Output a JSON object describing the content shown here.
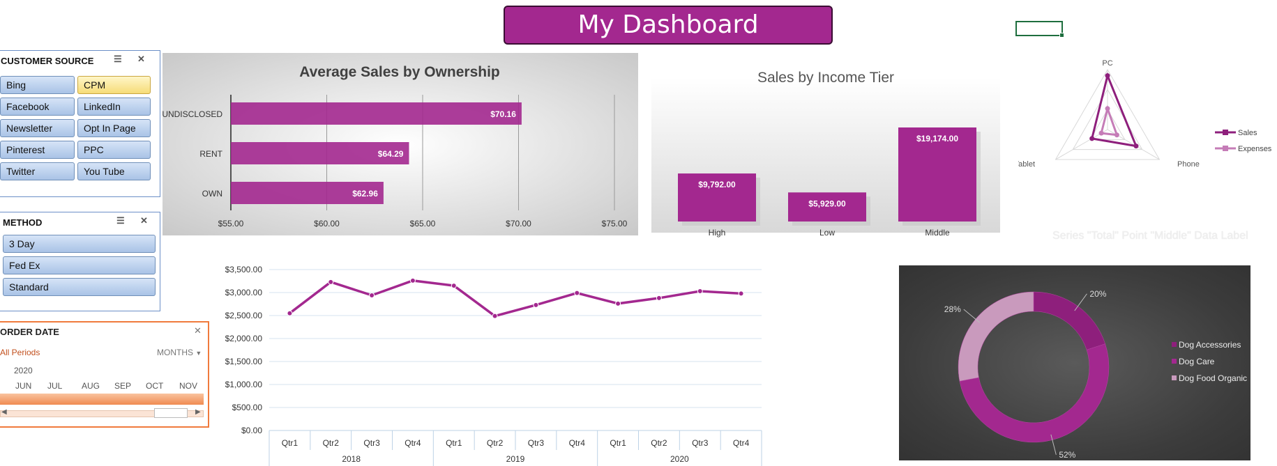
{
  "dashboard": {
    "title": "My Dashboard",
    "ghost_label": "Series \"Total\" Point \"Middle\" Data Label"
  },
  "slicers": {
    "customer_source": {
      "title": "CUSTOMER SOURCE",
      "items": [
        "Bing",
        "CPM",
        "Facebook",
        "LinkedIn",
        "Newsletter",
        "Opt In Page",
        "Pinterest",
        "PPC",
        "Twitter",
        "You Tube"
      ],
      "selected": "CPM"
    },
    "method": {
      "title": "METHOD",
      "items": [
        "3 Day",
        "Fed Ex",
        "Standard"
      ]
    }
  },
  "timeline": {
    "title": "ORDER DATE",
    "period_label": "All Periods",
    "level_label": "MONTHS",
    "year": "2020",
    "months": [
      "JUN",
      "JUL",
      "AUG",
      "SEP",
      "OCT",
      "NOV"
    ]
  },
  "charts": {
    "ownership": {
      "title": "Average Sales by Ownership",
      "data_labels": [
        "$70.16",
        "$64.29",
        "$62.96"
      ],
      "ticks": [
        "$55.00",
        "$60.00",
        "$65.00",
        "$70.00",
        "$75.00"
      ]
    },
    "income": {
      "title": "Sales by Income Tier",
      "data_labels": [
        "$9,792.00",
        "$5,929.00",
        "$19,174.00"
      ]
    },
    "radar": {
      "axes": [
        "PC",
        "Phone",
        "Tablet"
      ],
      "legend": [
        "Sales",
        "Expenses"
      ]
    },
    "trend": {
      "y_ticks": [
        "$3,500.00",
        "$3,000.00",
        "$2,500.00",
        "$2,000.00",
        "$1,500.00",
        "$1,000.00",
        "$500.00",
        "$0.00"
      ],
      "quarters": [
        "Qtr1",
        "Qtr2",
        "Qtr3",
        "Qtr4",
        "Qtr1",
        "Qtr2",
        "Qtr3",
        "Qtr4",
        "Qtr1",
        "Qtr2",
        "Qtr3",
        "Qtr4"
      ],
      "years": [
        "2018",
        "2019",
        "2020"
      ]
    },
    "donut": {
      "labels": [
        "20%",
        "52%",
        "28%"
      ],
      "legend": [
        "Dog Accessories",
        "Dog Care",
        "Dog Food Organic"
      ]
    }
  },
  "chart_data": [
    {
      "type": "bar",
      "title": "Average Sales by Ownership",
      "categories": [
        "UNDISCLOSED",
        "RENT",
        "OWN"
      ],
      "values": [
        70.16,
        64.29,
        62.96
      ],
      "xlim": [
        55,
        75
      ],
      "orientation": "horizontal",
      "color": "#a3288f"
    },
    {
      "type": "bar",
      "title": "Sales by Income Tier",
      "categories": [
        "High",
        "Low",
        "Middle"
      ],
      "values": [
        9792,
        5929,
        19174
      ],
      "color": "#a3288f"
    },
    {
      "type": "radar",
      "categories": [
        "PC",
        "Phone",
        "Tablet"
      ],
      "series": [
        {
          "name": "Sales",
          "values": [
            0.9,
            0.55,
            0.3
          ]
        },
        {
          "name": "Expenses",
          "values": [
            0.35,
            0.18,
            0.12
          ]
        }
      ],
      "legend": "right"
    },
    {
      "type": "line",
      "categories": [
        "Qtr1",
        "Qtr2",
        "Qtr3",
        "Qtr4",
        "Qtr1",
        "Qtr2",
        "Qtr3",
        "Qtr4",
        "Qtr1",
        "Qtr2",
        "Qtr3",
        "Qtr4"
      ],
      "groups": [
        "2018",
        "2019",
        "2020"
      ],
      "values": [
        2550,
        3230,
        2940,
        3260,
        3150,
        2490,
        2730,
        2990,
        2760,
        2880,
        3030,
        2980
      ],
      "ylim": [
        0,
        3500
      ],
      "color": "#a3288f"
    },
    {
      "type": "pie",
      "categories": [
        "Dog Accessories",
        "Dog Care",
        "Dog Food Organic"
      ],
      "values": [
        20,
        52,
        28
      ],
      "colors": [
        "#8e1f7c",
        "#a3288f",
        "#c99abd"
      ],
      "legend": "right"
    }
  ]
}
